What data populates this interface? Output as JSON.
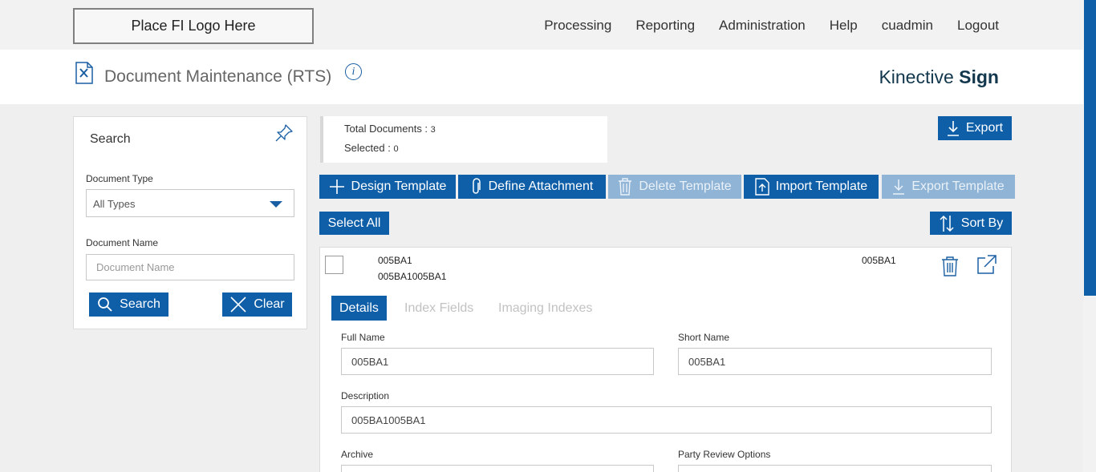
{
  "logo_text": "Place FI Logo Here",
  "nav": [
    "Processing",
    "Reporting",
    "Administration",
    "Help",
    "cuadmin",
    "Logout"
  ],
  "header": {
    "title": "Document Maintenance (RTS)",
    "info_icon": "i",
    "brand_light": "Kinective",
    "brand_bold": "Sign"
  },
  "search": {
    "title": "Search",
    "doc_type_label": "Document Type",
    "doc_type_value": "All Types",
    "doc_name_label": "Document Name",
    "doc_name_placeholder": "Document Name",
    "search_btn": "Search",
    "clear_btn": "Clear"
  },
  "totals": {
    "total_label": "Total Documents : ",
    "total_value": "3",
    "selected_label": "Selected : ",
    "selected_value": "0"
  },
  "toolbar": {
    "export": "Export",
    "design_template": "Design Template",
    "define_attachment": "Define Attachment",
    "delete_template": "Delete Template",
    "import_template": "Import Template",
    "export_template": "Export Template",
    "select_all": "Select All",
    "sort_by": "Sort By"
  },
  "document": {
    "code": "005BA1",
    "description": "005BA1005BA1",
    "short_code": "005BA1",
    "tabs": [
      "Details",
      "Index Fields",
      "Imaging Indexes"
    ],
    "full_name_label": "Full Name",
    "full_name_value": "005BA1",
    "short_name_label": "Short Name",
    "short_name_value": "005BA1",
    "description_label": "Description",
    "description_value": "005BA1005BA1",
    "archive_label": "Archive",
    "party_review_label": "Party Review Options"
  },
  "colors": {
    "primary": "#0e5ea8",
    "disabled": "#8fb4d6",
    "brand_text": "#13384d"
  }
}
